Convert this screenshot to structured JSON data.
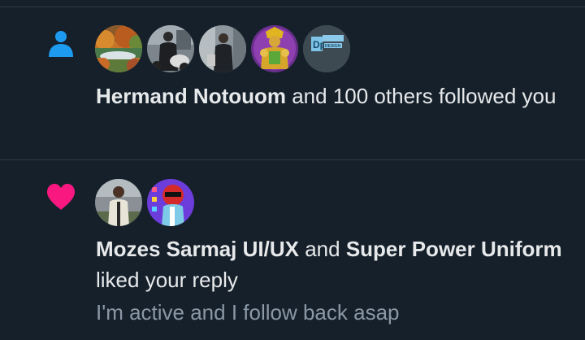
{
  "notifications": [
    {
      "type_icon": "person-icon",
      "avatars": [
        "avatar-autumn-landscape",
        "avatar-motorcycle-rider",
        "avatar-man-suit",
        "avatar-gold-character",
        "avatar-design-logo"
      ],
      "actor": "Hermand Notouom",
      "text": " and 100 others followed you"
    },
    {
      "type_icon": "heart-icon",
      "avatars": [
        "avatar-man-jacket",
        "avatar-red-character"
      ],
      "actor1": "Mozes Sarmaj UI/UX",
      "joiner": " and ",
      "actor2": "Super Power Uniform",
      "text": " liked your reply",
      "subtext": "I'm active and I follow back asap"
    }
  ],
  "colors": {
    "background": "#15202b",
    "text": "#e7e9ea",
    "muted": "#8b98a5",
    "follow_icon": "#1d9bf0",
    "like_icon": "#f91880",
    "divider": "#2f3b47"
  },
  "logo_text": "DESIGN"
}
